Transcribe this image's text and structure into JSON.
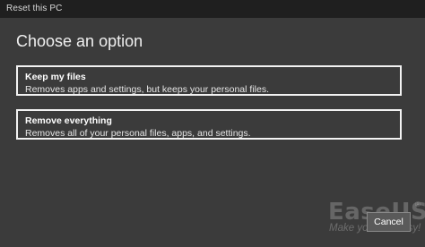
{
  "window": {
    "title": "Reset this PC"
  },
  "main": {
    "heading": "Choose an option",
    "options": [
      {
        "title": "Keep my files",
        "description": "Removes apps and settings, but keeps your personal files."
      },
      {
        "title": "Remove everything",
        "description": "Removes all of your personal files, apps, and settings."
      }
    ]
  },
  "footer": {
    "cancel_label": "Cancel"
  },
  "watermark": {
    "brand": "EaseUS",
    "registered": "®",
    "tagline": "Make your life easy!"
  },
  "colors": {
    "background": "#3b3b3b",
    "titlebar": "#1f1f1f",
    "option_border": "#f2f2f2",
    "text": "#ffffff"
  }
}
